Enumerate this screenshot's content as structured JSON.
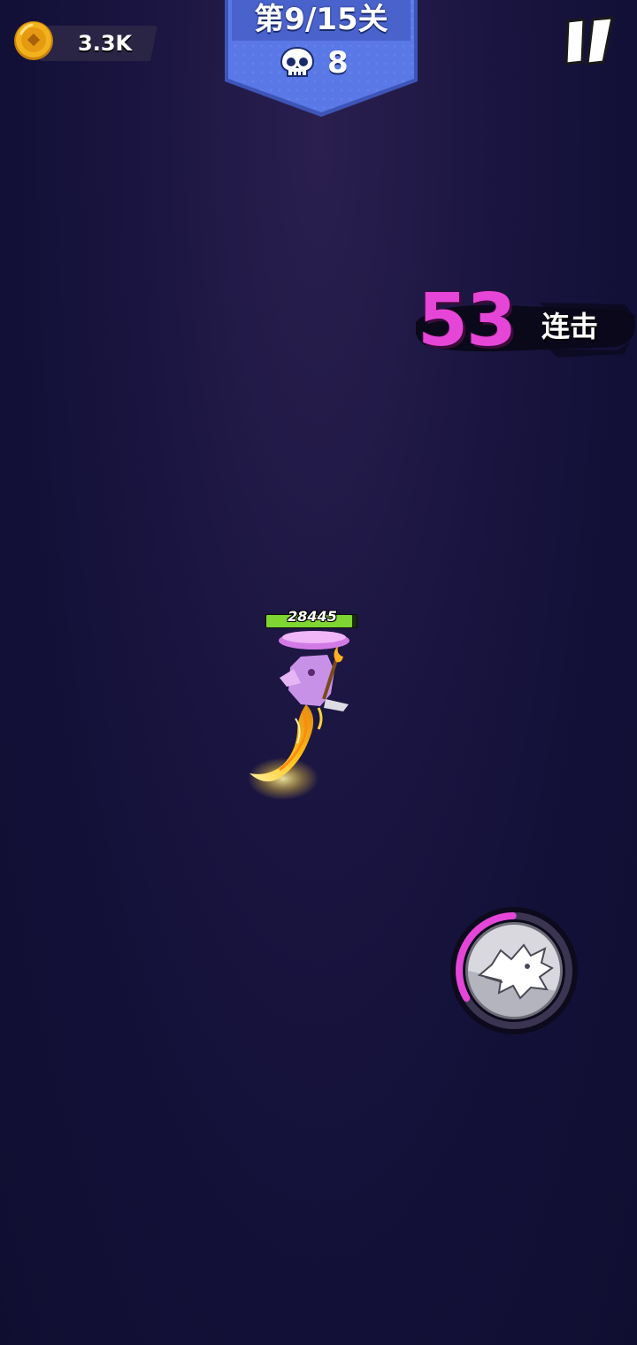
{
  "hud": {
    "coins": "3.3K",
    "level_title": "第9/15关",
    "kills": "8"
  },
  "combo": {
    "count": "53",
    "label": "连击"
  },
  "hero": {
    "hp_value": "28445",
    "hp_fraction": 0.95
  },
  "skill": {
    "icon": "dragon-icon",
    "cooldown_fraction": 0.33
  },
  "colors": {
    "combo_accent": "#e646d8",
    "hp_fill": "#7fd531",
    "coin_gold": "#f2b21c",
    "banner_blue": "#5a78e6"
  }
}
